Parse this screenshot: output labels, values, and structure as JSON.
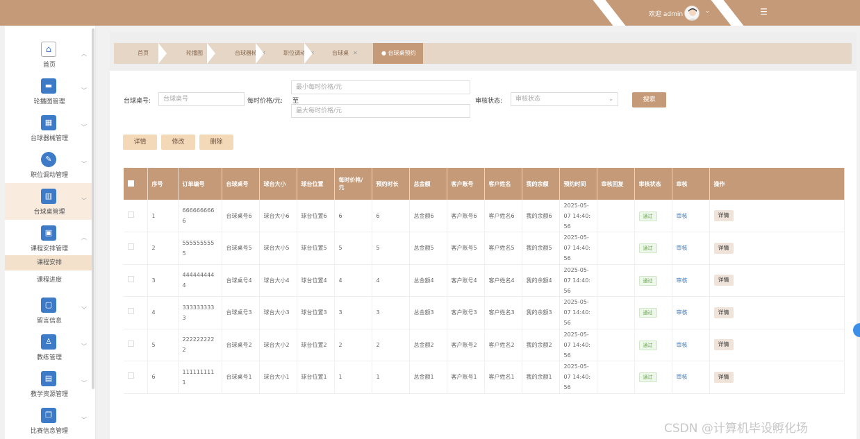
{
  "header": {
    "welcome": "欢迎 admin"
  },
  "sidebar": {
    "items": [
      {
        "label": "首页",
        "icon": "home-icon"
      },
      {
        "label": "轮播图管理",
        "icon": "carousel-icon"
      },
      {
        "label": "台球器械管理",
        "icon": "grid-icon"
      },
      {
        "label": "职位调动管理",
        "icon": "edit-icon"
      },
      {
        "label": "台球桌管理",
        "icon": "chart-icon"
      },
      {
        "label": "课程安排管理",
        "icon": "badge-icon"
      },
      {
        "label": "留言信息",
        "icon": "message-icon"
      },
      {
        "label": "教练管理",
        "icon": "coach-icon"
      },
      {
        "label": "教学资源管理",
        "icon": "box-icon"
      },
      {
        "label": "比赛信息管理",
        "icon": "copy-icon"
      }
    ],
    "subitems": [
      {
        "label": "课程安排"
      },
      {
        "label": "课程进度"
      }
    ]
  },
  "breadcrumbs": [
    {
      "label": "首页"
    },
    {
      "label": "轮播图"
    },
    {
      "label": "台球器械"
    },
    {
      "label": "职位调动"
    },
    {
      "label": "台球桌"
    },
    {
      "label": "● 台球桌预约"
    }
  ],
  "search": {
    "table_label": "台球桌号:",
    "table_placeholder": "台球桌号",
    "price_label": "每时价格/元:",
    "min_placeholder": "最小每时价格/元",
    "to": "至",
    "max_placeholder": "最大每时价格/元",
    "status_label": "审核状态:",
    "status_placeholder": "审核状态",
    "search_button": "搜索"
  },
  "actions": {
    "detail": "详情",
    "edit": "修改",
    "delete": "删除"
  },
  "table": {
    "columns": [
      "序号",
      "订单编号",
      "台球桌号",
      "球台大小",
      "球台位置",
      "每时价格/元",
      "预约时长",
      "总金额",
      "客户账号",
      "客户姓名",
      "我的余额",
      "预约时间",
      "审核回复",
      "审核状态",
      "审核",
      "操作"
    ],
    "rows": [
      {
        "no": "1",
        "order": "6666666666",
        "table_no": "台球桌号6",
        "size": "球台大小6",
        "pos": "球台位置6",
        "price": "6",
        "dur": "6",
        "total": "总金额6",
        "acct": "客户账号6",
        "name": "客户姓名6",
        "bal": "我的余额6",
        "time": "2025-05-07 14:40:56",
        "reply": "",
        "status": "通过",
        "review": "审核",
        "op": "详情"
      },
      {
        "no": "2",
        "order": "5555555555",
        "table_no": "台球桌号5",
        "size": "球台大小5",
        "pos": "球台位置5",
        "price": "5",
        "dur": "5",
        "total": "总金额5",
        "acct": "客户账号5",
        "name": "客户姓名5",
        "bal": "我的余额5",
        "time": "2025-05-07 14:40:56",
        "reply": "",
        "status": "通过",
        "review": "审核",
        "op": "详情"
      },
      {
        "no": "3",
        "order": "4444444444",
        "table_no": "台球桌号4",
        "size": "球台大小4",
        "pos": "球台位置4",
        "price": "4",
        "dur": "4",
        "total": "总金额4",
        "acct": "客户账号4",
        "name": "客户姓名4",
        "bal": "我的余额4",
        "time": "2025-05-07 14:40:56",
        "reply": "",
        "status": "通过",
        "review": "审核",
        "op": "详情"
      },
      {
        "no": "4",
        "order": "3333333333",
        "table_no": "台球桌号3",
        "size": "球台大小3",
        "pos": "球台位置3",
        "price": "3",
        "dur": "3",
        "total": "总金额3",
        "acct": "客户账号3",
        "name": "客户姓名3",
        "bal": "我的余额3",
        "time": "2025-05-07 14:40:56",
        "reply": "",
        "status": "通过",
        "review": "审核",
        "op": "详情"
      },
      {
        "no": "5",
        "order": "2222222222",
        "table_no": "台球桌号2",
        "size": "球台大小2",
        "pos": "球台位置2",
        "price": "2",
        "dur": "2",
        "total": "总金额2",
        "acct": "客户账号2",
        "name": "客户姓名2",
        "bal": "我的余额2",
        "time": "2025-05-07 14:40:56",
        "reply": "",
        "status": "通过",
        "review": "审核",
        "op": "详情"
      },
      {
        "no": "6",
        "order": "1111111111",
        "table_no": "台球桌号1",
        "size": "球台大小1",
        "pos": "球台位置1",
        "price": "1",
        "dur": "1",
        "total": "总金额1",
        "acct": "客户账号1",
        "name": "客户姓名1",
        "bal": "我的余额1",
        "time": "2025-05-07 14:40:56",
        "reply": "",
        "status": "通过",
        "review": "审核",
        "op": "详情"
      }
    ]
  },
  "watermark": "CSDN @计算机毕设孵化场",
  "colors": {
    "brand": "#c49a78",
    "link": "#3d7ac7",
    "pass": "#67a54a"
  }
}
